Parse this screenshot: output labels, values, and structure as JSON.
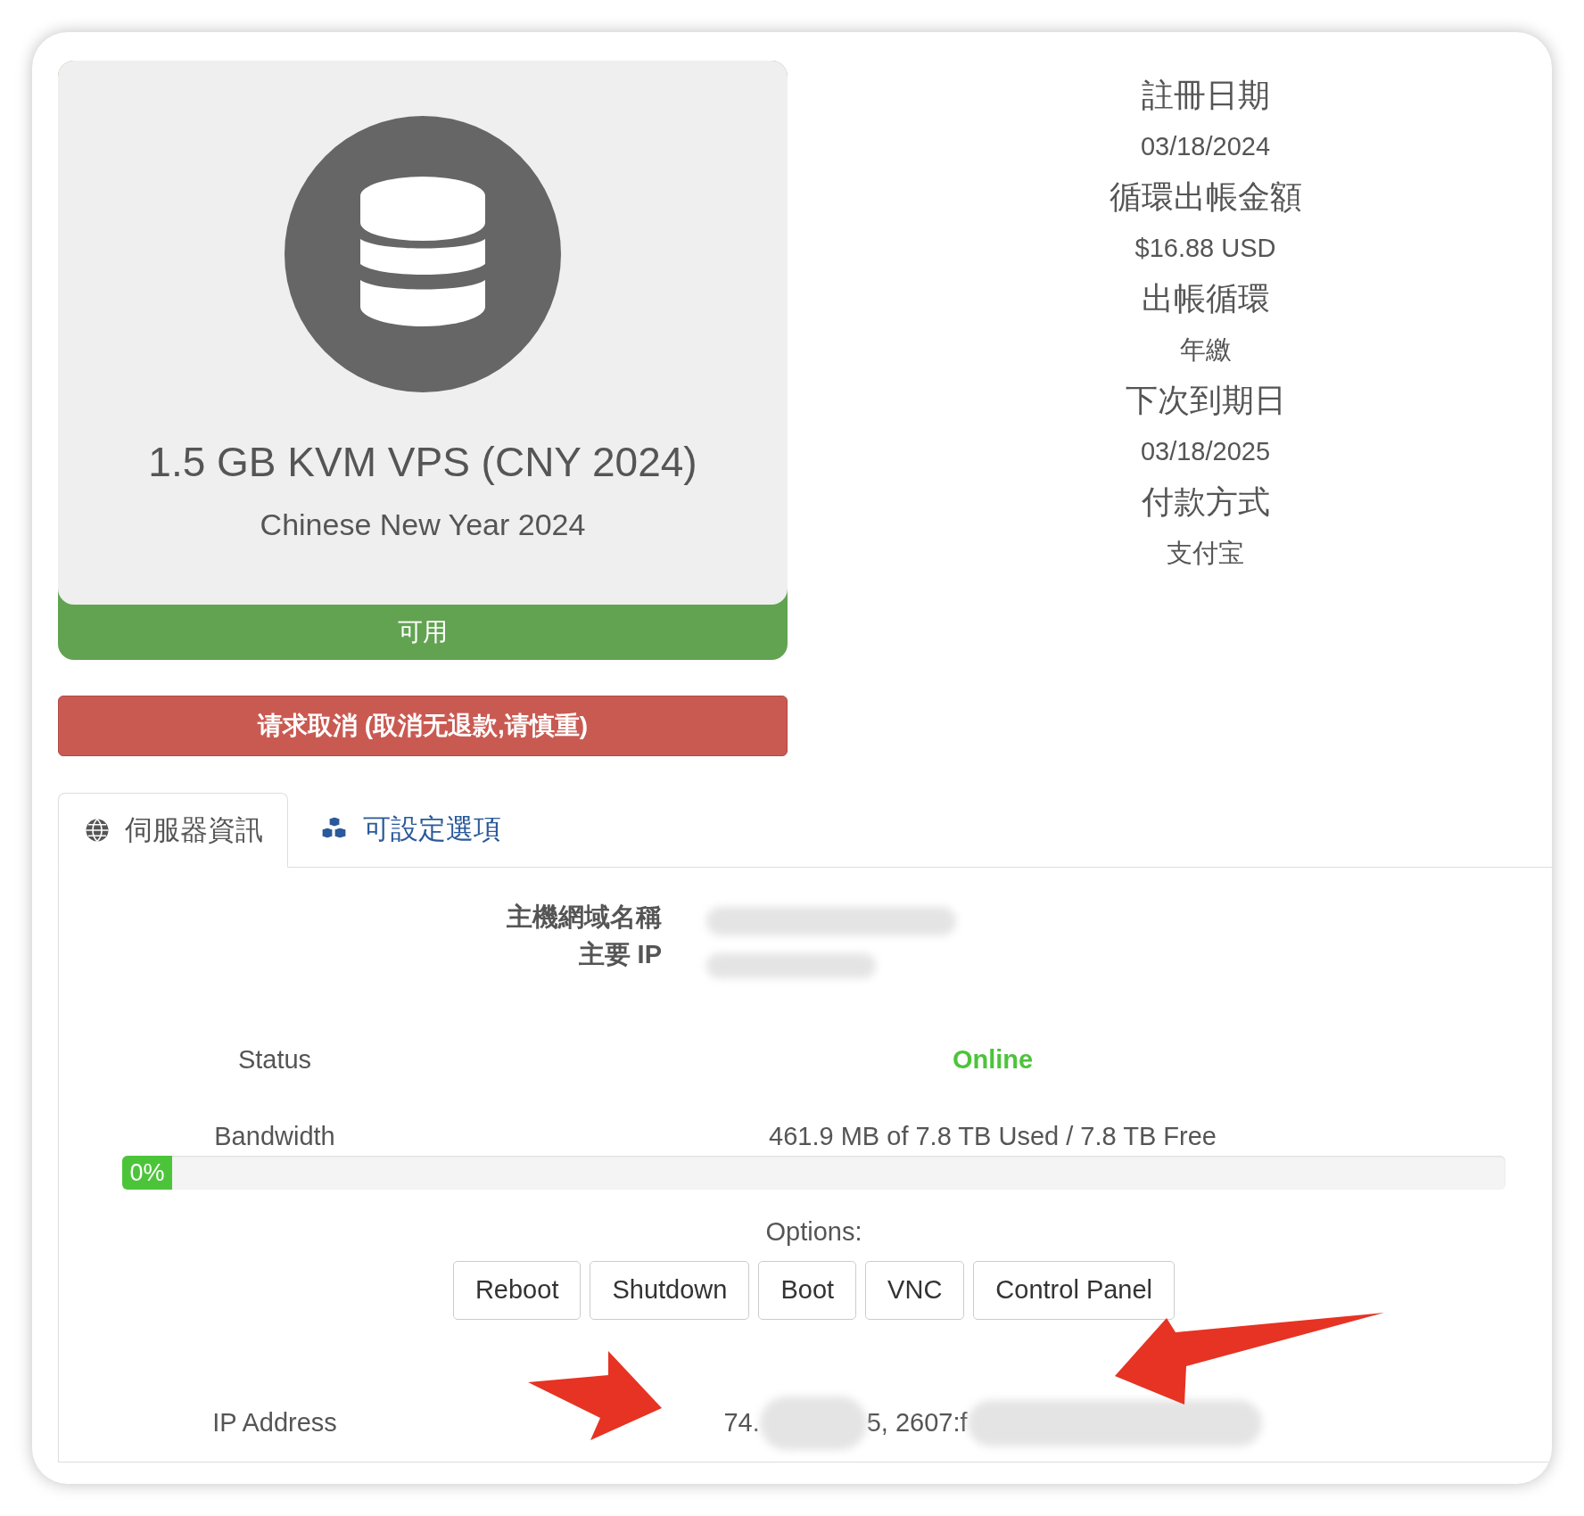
{
  "product": {
    "title": "1.5 GB KVM VPS (CNY 2024)",
    "subtitle": "Chinese New Year 2024",
    "status": "可用"
  },
  "cancel_button": "请求取消 (取消无退款,请慎重)",
  "details": [
    {
      "label": "註冊日期",
      "value": "03/18/2024"
    },
    {
      "label": "循環出帳金額",
      "value": "$16.88 USD"
    },
    {
      "label": "出帳循環",
      "value": "年繳"
    },
    {
      "label": "下次到期日",
      "value": "03/18/2025"
    },
    {
      "label": "付款方式",
      "value": "支付宝"
    }
  ],
  "tabs": [
    {
      "label": "伺服器資訊",
      "selected": true,
      "kind": "globe"
    },
    {
      "label": "可設定選項",
      "selected": false,
      "kind": "cubes"
    }
  ],
  "server": {
    "hostname_label": "主機網域名稱",
    "primary_ip_label": "主要 IP"
  },
  "status": {
    "label": "Status",
    "value": "Online"
  },
  "bandwidth": {
    "label": "Bandwidth",
    "reading": "461.9 MB of 7.8 TB Used / 7.8 TB Free",
    "level": 0,
    "percent": "0%"
  },
  "options": {
    "label": "Options:",
    "buttons": [
      "Reboot",
      "Shutdown",
      "Boot",
      "VNC",
      "Control Panel"
    ]
  },
  "ip_address": {
    "label": "IP Address",
    "parts": [
      "74.",
      "5, 2607:f"
    ]
  }
}
